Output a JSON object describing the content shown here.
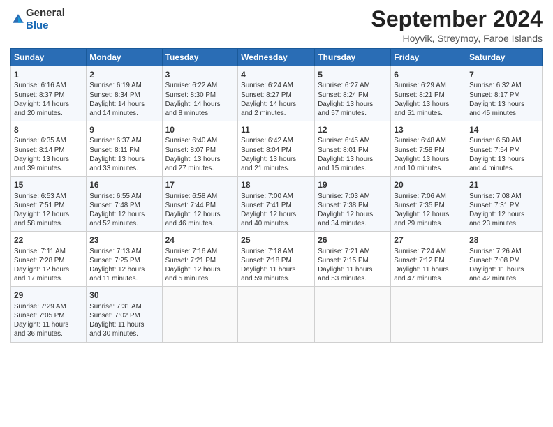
{
  "header": {
    "logo_general": "General",
    "logo_blue": "Blue",
    "title": "September 2024",
    "subtitle": "Hoyvik, Streymoy, Faroe Islands"
  },
  "days_of_week": [
    "Sunday",
    "Monday",
    "Tuesday",
    "Wednesday",
    "Thursday",
    "Friday",
    "Saturday"
  ],
  "weeks": [
    [
      {
        "day": 1,
        "info": "Sunrise: 6:16 AM\nSunset: 8:37 PM\nDaylight: 14 hours\nand 20 minutes."
      },
      {
        "day": 2,
        "info": "Sunrise: 6:19 AM\nSunset: 8:34 PM\nDaylight: 14 hours\nand 14 minutes."
      },
      {
        "day": 3,
        "info": "Sunrise: 6:22 AM\nSunset: 8:30 PM\nDaylight: 14 hours\nand 8 minutes."
      },
      {
        "day": 4,
        "info": "Sunrise: 6:24 AM\nSunset: 8:27 PM\nDaylight: 14 hours\nand 2 minutes."
      },
      {
        "day": 5,
        "info": "Sunrise: 6:27 AM\nSunset: 8:24 PM\nDaylight: 13 hours\nand 57 minutes."
      },
      {
        "day": 6,
        "info": "Sunrise: 6:29 AM\nSunset: 8:21 PM\nDaylight: 13 hours\nand 51 minutes."
      },
      {
        "day": 7,
        "info": "Sunrise: 6:32 AM\nSunset: 8:17 PM\nDaylight: 13 hours\nand 45 minutes."
      }
    ],
    [
      {
        "day": 8,
        "info": "Sunrise: 6:35 AM\nSunset: 8:14 PM\nDaylight: 13 hours\nand 39 minutes."
      },
      {
        "day": 9,
        "info": "Sunrise: 6:37 AM\nSunset: 8:11 PM\nDaylight: 13 hours\nand 33 minutes."
      },
      {
        "day": 10,
        "info": "Sunrise: 6:40 AM\nSunset: 8:07 PM\nDaylight: 13 hours\nand 27 minutes."
      },
      {
        "day": 11,
        "info": "Sunrise: 6:42 AM\nSunset: 8:04 PM\nDaylight: 13 hours\nand 21 minutes."
      },
      {
        "day": 12,
        "info": "Sunrise: 6:45 AM\nSunset: 8:01 PM\nDaylight: 13 hours\nand 15 minutes."
      },
      {
        "day": 13,
        "info": "Sunrise: 6:48 AM\nSunset: 7:58 PM\nDaylight: 13 hours\nand 10 minutes."
      },
      {
        "day": 14,
        "info": "Sunrise: 6:50 AM\nSunset: 7:54 PM\nDaylight: 13 hours\nand 4 minutes."
      }
    ],
    [
      {
        "day": 15,
        "info": "Sunrise: 6:53 AM\nSunset: 7:51 PM\nDaylight: 12 hours\nand 58 minutes."
      },
      {
        "day": 16,
        "info": "Sunrise: 6:55 AM\nSunset: 7:48 PM\nDaylight: 12 hours\nand 52 minutes."
      },
      {
        "day": 17,
        "info": "Sunrise: 6:58 AM\nSunset: 7:44 PM\nDaylight: 12 hours\nand 46 minutes."
      },
      {
        "day": 18,
        "info": "Sunrise: 7:00 AM\nSunset: 7:41 PM\nDaylight: 12 hours\nand 40 minutes."
      },
      {
        "day": 19,
        "info": "Sunrise: 7:03 AM\nSunset: 7:38 PM\nDaylight: 12 hours\nand 34 minutes."
      },
      {
        "day": 20,
        "info": "Sunrise: 7:06 AM\nSunset: 7:35 PM\nDaylight: 12 hours\nand 29 minutes."
      },
      {
        "day": 21,
        "info": "Sunrise: 7:08 AM\nSunset: 7:31 PM\nDaylight: 12 hours\nand 23 minutes."
      }
    ],
    [
      {
        "day": 22,
        "info": "Sunrise: 7:11 AM\nSunset: 7:28 PM\nDaylight: 12 hours\nand 17 minutes."
      },
      {
        "day": 23,
        "info": "Sunrise: 7:13 AM\nSunset: 7:25 PM\nDaylight: 12 hours\nand 11 minutes."
      },
      {
        "day": 24,
        "info": "Sunrise: 7:16 AM\nSunset: 7:21 PM\nDaylight: 12 hours\nand 5 minutes."
      },
      {
        "day": 25,
        "info": "Sunrise: 7:18 AM\nSunset: 7:18 PM\nDaylight: 11 hours\nand 59 minutes."
      },
      {
        "day": 26,
        "info": "Sunrise: 7:21 AM\nSunset: 7:15 PM\nDaylight: 11 hours\nand 53 minutes."
      },
      {
        "day": 27,
        "info": "Sunrise: 7:24 AM\nSunset: 7:12 PM\nDaylight: 11 hours\nand 47 minutes."
      },
      {
        "day": 28,
        "info": "Sunrise: 7:26 AM\nSunset: 7:08 PM\nDaylight: 11 hours\nand 42 minutes."
      }
    ],
    [
      {
        "day": 29,
        "info": "Sunrise: 7:29 AM\nSunset: 7:05 PM\nDaylight: 11 hours\nand 36 minutes."
      },
      {
        "day": 30,
        "info": "Sunrise: 7:31 AM\nSunset: 7:02 PM\nDaylight: 11 hours\nand 30 minutes."
      },
      {
        "day": null,
        "info": ""
      },
      {
        "day": null,
        "info": ""
      },
      {
        "day": null,
        "info": ""
      },
      {
        "day": null,
        "info": ""
      },
      {
        "day": null,
        "info": ""
      }
    ]
  ]
}
